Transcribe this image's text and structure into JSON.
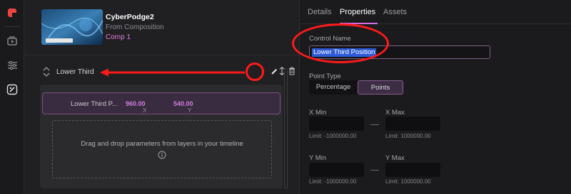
{
  "rail": {
    "icons": [
      "logo-icon",
      "media-play-icon",
      "sliders-icon",
      "controls-icon"
    ]
  },
  "composition": {
    "name": "CyberPodge2",
    "source": "From Composition",
    "comp": "Comp 1"
  },
  "group": {
    "label": "Lower Third"
  },
  "parameter": {
    "label": "Lower Third P...",
    "x_value": "960.00",
    "y_value": "540.00",
    "x_label": "X",
    "y_label": "Y"
  },
  "dropzone": {
    "text": "Drag and drop parameters from layers in your timeline"
  },
  "tabs": [
    "Details",
    "Properties",
    "Assets"
  ],
  "properties": {
    "control_name_label": "Control Name",
    "control_name_value": "Lower Third Position",
    "point_type_label": "Point Type",
    "point_type_options": [
      "Percentage",
      "Points"
    ],
    "point_type_selected": "Points",
    "x_min_label": "X Min",
    "x_max_label": "X Max",
    "x_min_limit": "Limit: -1000000.00",
    "x_max_limit": "Limit: 1000000.00",
    "y_min_label": "Y Min",
    "y_max_label": "Y Max",
    "y_min_limit": "Limit: -1000000.00",
    "y_max_limit": "Limit: 1000000.00"
  },
  "colors": {
    "accent": "#d66ee0",
    "annotation": "#ff1a1a",
    "logo": "#e8453c"
  }
}
